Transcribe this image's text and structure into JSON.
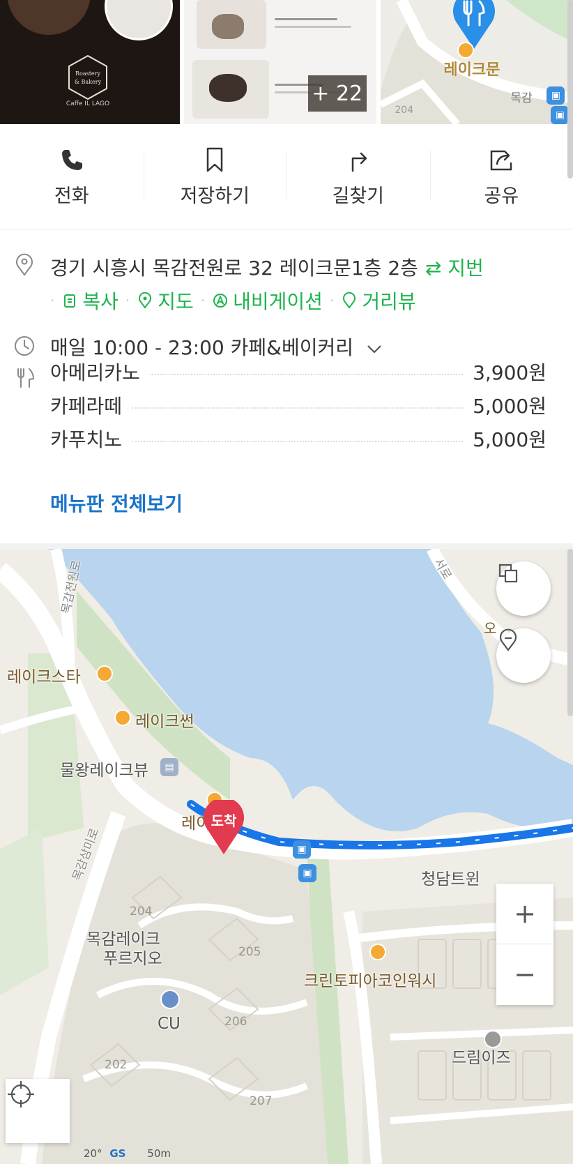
{
  "photos": {
    "logo_line1": "Roastery",
    "logo_line2": "& Bakery",
    "logo_sub": "Caffe IL LAGO",
    "more_count": "+ 22",
    "map_label": "레이크문",
    "map_small_label": "목감",
    "map_number": "204"
  },
  "actions": [
    {
      "label": "전화",
      "icon": "phone-icon"
    },
    {
      "label": "저장하기",
      "icon": "bookmark-icon"
    },
    {
      "label": "길찾기",
      "icon": "directions-icon"
    },
    {
      "label": "공유",
      "icon": "share-icon"
    }
  ],
  "info": {
    "address": "경기 시흥시 목감전원로 32 레이크문1층 2층",
    "address_toggle": "⇄ 지번",
    "links": {
      "copy": "복사",
      "map": "지도",
      "navigation": "내비게이션",
      "street_view": "거리뷰"
    },
    "hours": "매일 10:00 - 23:00 카페&베이커리",
    "menu": [
      {
        "name": "아메리카노",
        "price": "3,900원"
      },
      {
        "name": "카페라떼",
        "price": "5,000원"
      },
      {
        "name": "카푸치노",
        "price": "5,000원"
      }
    ],
    "menu_all": "메뉴판 전체보기"
  },
  "map": {
    "destination": "도착",
    "labels": {
      "lakestar": "레이크스타",
      "lakesun": "레이크썬",
      "mulwang": "물왕레이크뷰",
      "lakemoon": "레이크문",
      "cheongdam": "청담트윈",
      "mokgam_purzio_1": "목감레이크",
      "mokgam_purzio_2": "푸르지오",
      "cleantopia": "크린토피아코인워시",
      "cu": "CU",
      "dreamis": "드림이즈",
      "road_left": "목감전원로",
      "road_lower": "목감삼미로",
      "road_top": "서로",
      "edge_label": "오"
    },
    "numbers": {
      "n204": "204",
      "n205": "205",
      "n206": "206",
      "n202": "202",
      "n207": "207"
    },
    "scale_text": "50m",
    "gs_text": "GS",
    "temp_text": "20°",
    "zoom_in": "+",
    "zoom_out": "−"
  },
  "colors": {
    "green": "#1db44e",
    "blue_link": "#1a73c8",
    "route": "#1976e8",
    "pin_red": "#e23a4e",
    "pin_blue": "#2a8fe6",
    "water": "#b8d4ee"
  }
}
